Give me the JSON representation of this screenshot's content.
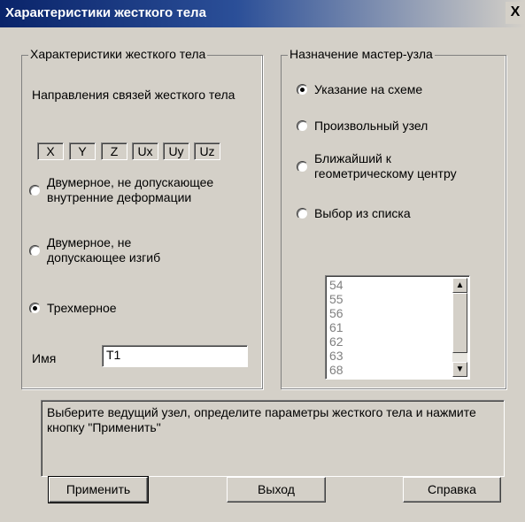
{
  "window": {
    "title": "Характеристики жесткого тела",
    "close_label": "X"
  },
  "left_group": {
    "legend": "Характеристики жесткого тела",
    "directions_label": "Направления связей жесткого тела",
    "directions": [
      "X",
      "Y",
      "Z",
      "Ux",
      "Uy",
      "Uz"
    ],
    "options": [
      {
        "label": "Двумерное, не допускающее внутренние деформации",
        "checked": false
      },
      {
        "label": "Двумерное, не допускающее изгиб",
        "checked": false
      },
      {
        "label": "Трехмерное",
        "checked": true
      }
    ],
    "name_label": "Имя",
    "name_value": "T1"
  },
  "right_group": {
    "legend": "Назначение мастер-узла",
    "options": [
      {
        "label": "Указание на схеме",
        "checked": true
      },
      {
        "label": "Произвольный узел",
        "checked": false
      },
      {
        "label": "Ближайший к геометрическому центру",
        "checked": false
      },
      {
        "label": "Выбор из списка",
        "checked": false
      }
    ],
    "list_items": [
      "54",
      "55",
      "56",
      "61",
      "62",
      "63",
      "68"
    ]
  },
  "status_text": "Выберите ведущий узел, определите параметры жесткого тела и нажмите кнопку \"Применить\"",
  "buttons": {
    "apply": "Применить",
    "exit": "Выход",
    "help": "Справка"
  }
}
